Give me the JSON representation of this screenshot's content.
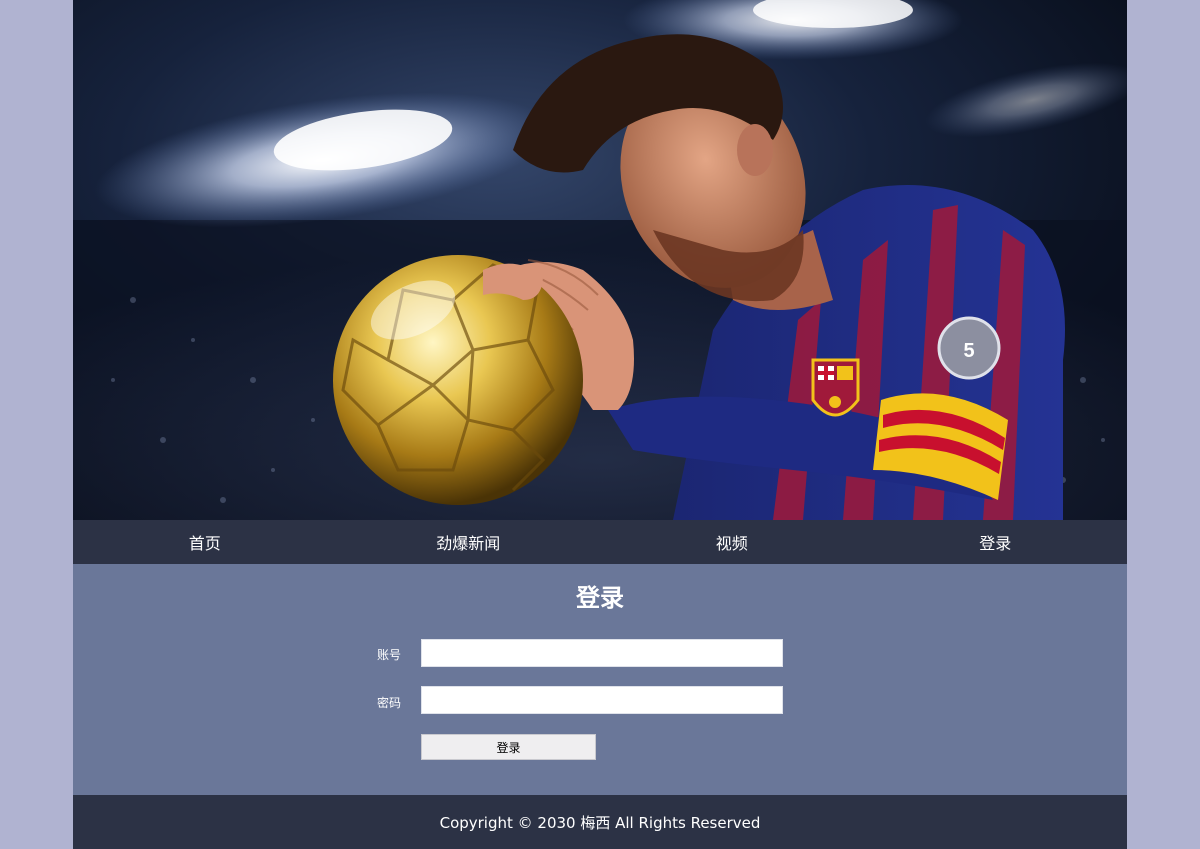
{
  "nav": {
    "items": [
      {
        "label": "首页"
      },
      {
        "label": "劲爆新闻"
      },
      {
        "label": "视频"
      },
      {
        "label": "登录"
      }
    ]
  },
  "login": {
    "title": "登录",
    "account_label": "账号",
    "account_value": "",
    "password_label": "密码",
    "password_value": "",
    "submit_label": "登录"
  },
  "footer": {
    "copyright": "Copyright © 2030 梅西 All Rights Reserved"
  },
  "colors": {
    "page_background": "#b0b3d1",
    "nav_background": "#2c3245",
    "login_background": "#6a7799",
    "footer_background": "#2c3245"
  }
}
